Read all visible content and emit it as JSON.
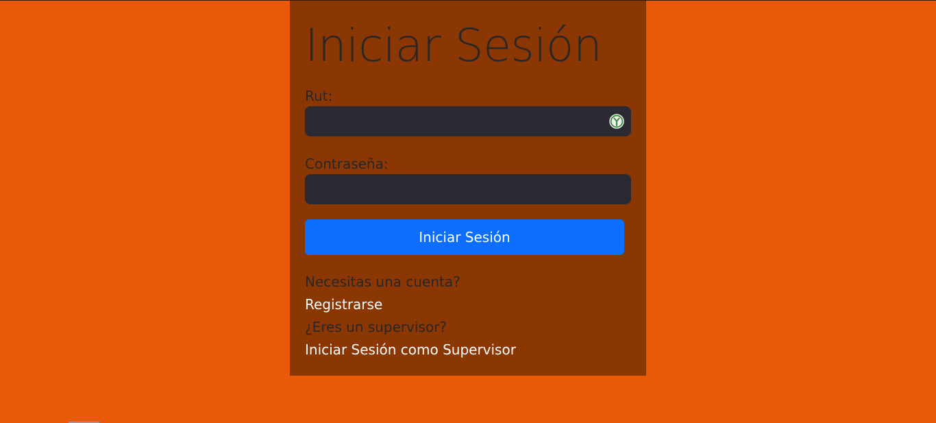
{
  "page": {
    "background_color": "#e85a0a",
    "panel_color": "#8a3704"
  },
  "login": {
    "title": "Iniciar Sesión",
    "rut_label": "Rut:",
    "rut_value": "",
    "rut_icon": "password-manager-key-icon",
    "password_label": "Contraseña:",
    "password_value": "",
    "submit_label": "Iniciar Sesión",
    "submit_color": "#0d6efd"
  },
  "footer": {
    "need_account_text": "Necesitas una cuenta?",
    "register_link": "Registrarse",
    "supervisor_question": "¿Eres un supervisor?",
    "supervisor_link": "Iniciar Sesión como Supervisor"
  }
}
